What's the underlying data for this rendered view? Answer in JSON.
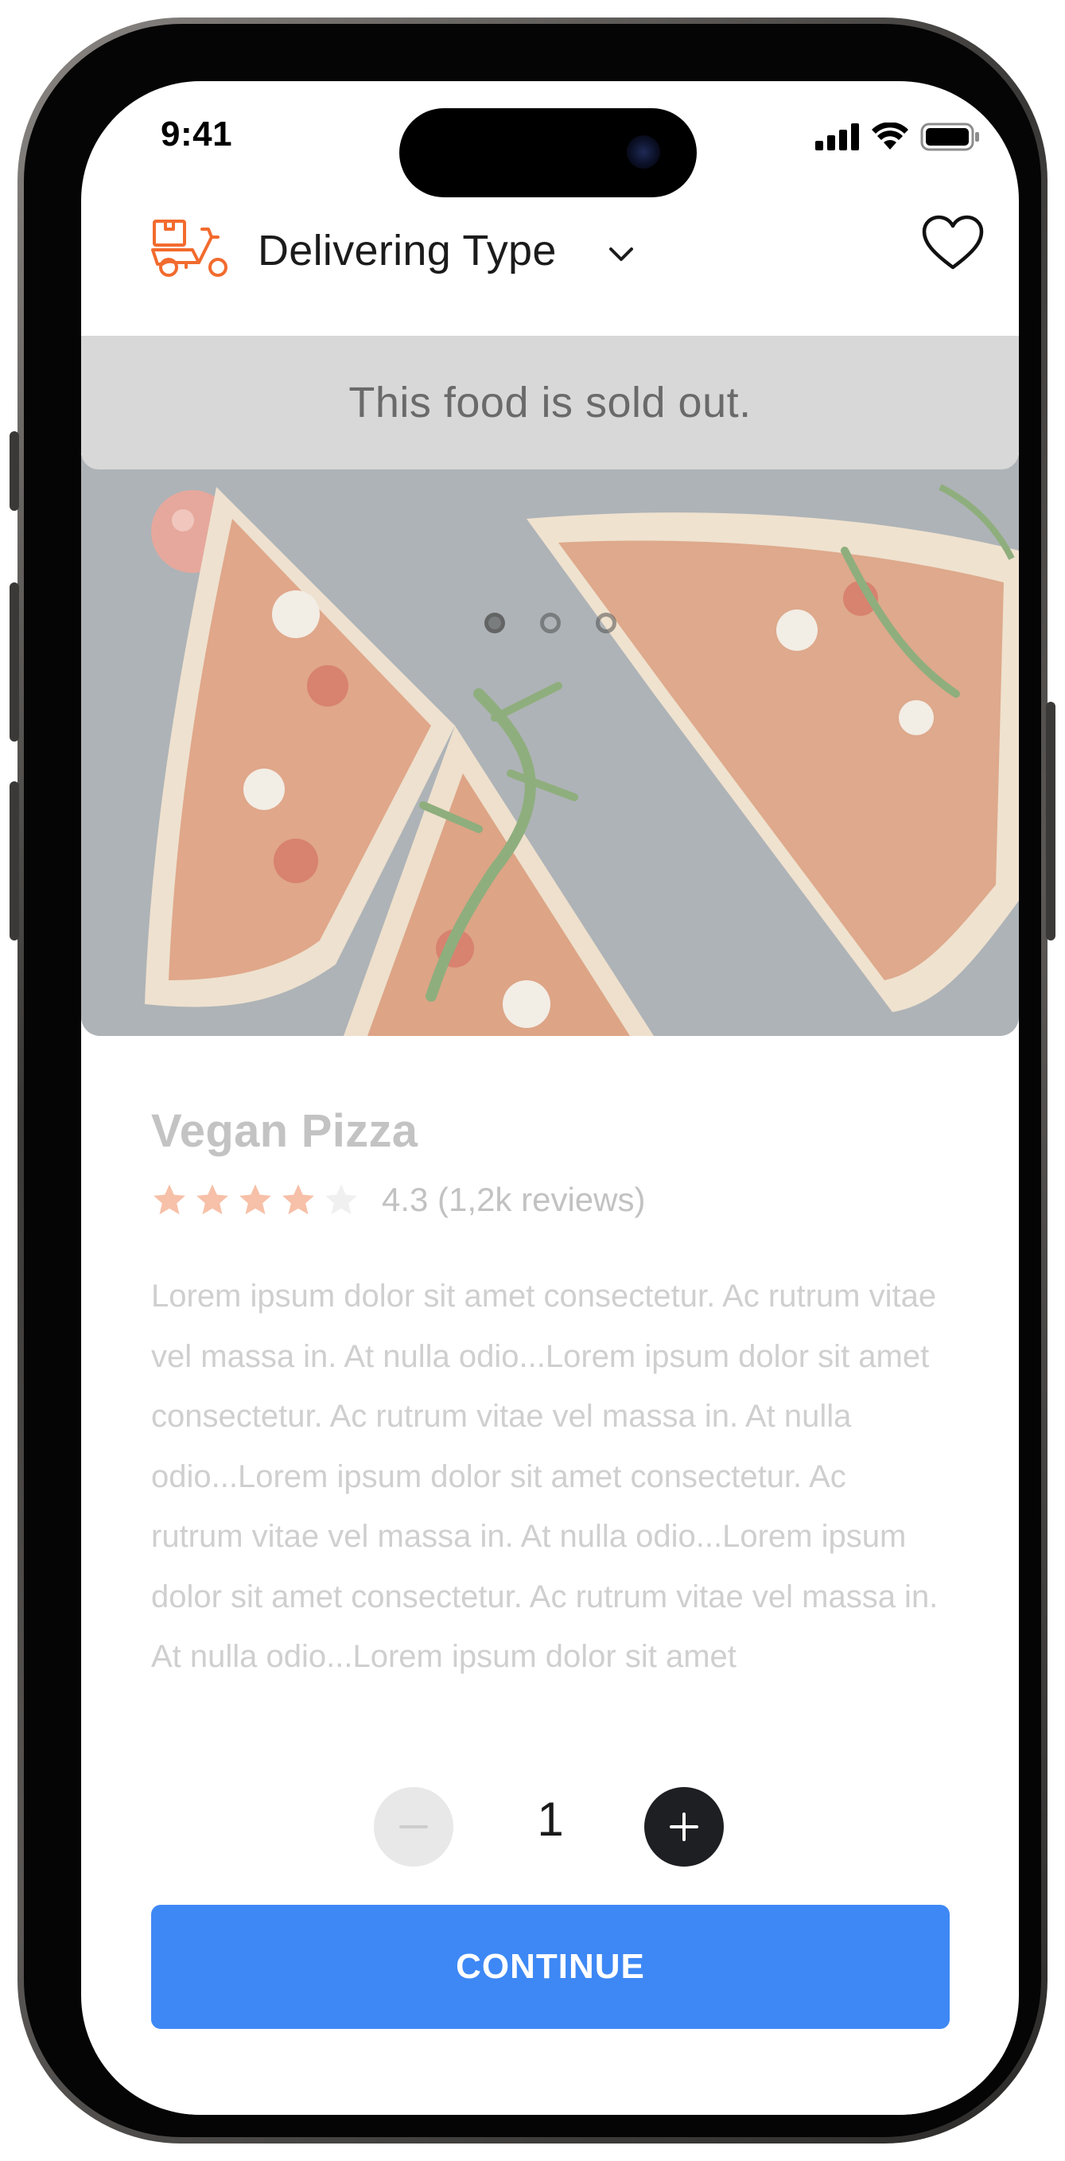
{
  "status_bar": {
    "time": "9:41"
  },
  "header": {
    "title": "Delivering Type",
    "icons": {
      "delivery": "scooter-delivery-icon",
      "dropdown": "chevron-down-icon",
      "favorite": "heart-icon"
    },
    "accent_color": "#F26B2E"
  },
  "banner": {
    "message": "This food is sold out."
  },
  "carousel": {
    "pages": 3,
    "active_index": 0
  },
  "product": {
    "name": "Vegan Pizza",
    "rating_value": 4,
    "rating_max": 5,
    "rating_text": "4.3 (1,2k reviews)",
    "description": "Lorem ipsum dolor sit amet consectetur. Ac rutrum vitae vel massa in. At nulla odio...Lorem ipsum dolor sit amet consectetur. Ac rutrum vitae vel massa in. At nulla odio...Lorem ipsum dolor sit amet consectetur. Ac rutrum vitae vel massa in. At nulla odio...Lorem ipsum dolor sit amet consectetur. Ac rutrum vitae vel massa in. At nulla odio...Lorem ipsum dolor sit amet"
  },
  "quantity": {
    "value": "1"
  },
  "actions": {
    "continue_label": "CONTINUE",
    "continue_color": "#3E88F5"
  }
}
